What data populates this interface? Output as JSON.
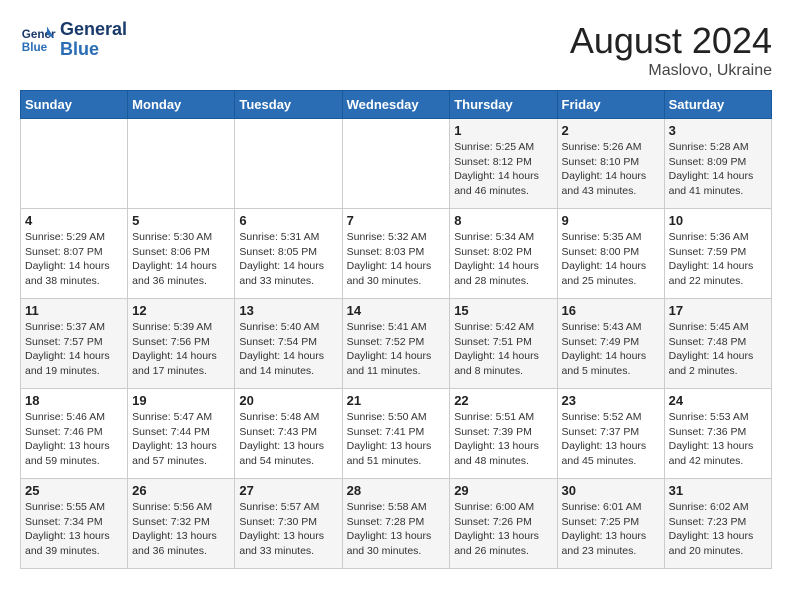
{
  "header": {
    "logo_line1": "General",
    "logo_line2": "Blue",
    "month_year": "August 2024",
    "location": "Maslovo, Ukraine"
  },
  "weekdays": [
    "Sunday",
    "Monday",
    "Tuesday",
    "Wednesday",
    "Thursday",
    "Friday",
    "Saturday"
  ],
  "weeks": [
    [
      {
        "day": "",
        "info": ""
      },
      {
        "day": "",
        "info": ""
      },
      {
        "day": "",
        "info": ""
      },
      {
        "day": "",
        "info": ""
      },
      {
        "day": "1",
        "info": "Sunrise: 5:25 AM\nSunset: 8:12 PM\nDaylight: 14 hours\nand 46 minutes."
      },
      {
        "day": "2",
        "info": "Sunrise: 5:26 AM\nSunset: 8:10 PM\nDaylight: 14 hours\nand 43 minutes."
      },
      {
        "day": "3",
        "info": "Sunrise: 5:28 AM\nSunset: 8:09 PM\nDaylight: 14 hours\nand 41 minutes."
      }
    ],
    [
      {
        "day": "4",
        "info": "Sunrise: 5:29 AM\nSunset: 8:07 PM\nDaylight: 14 hours\nand 38 minutes."
      },
      {
        "day": "5",
        "info": "Sunrise: 5:30 AM\nSunset: 8:06 PM\nDaylight: 14 hours\nand 36 minutes."
      },
      {
        "day": "6",
        "info": "Sunrise: 5:31 AM\nSunset: 8:05 PM\nDaylight: 14 hours\nand 33 minutes."
      },
      {
        "day": "7",
        "info": "Sunrise: 5:32 AM\nSunset: 8:03 PM\nDaylight: 14 hours\nand 30 minutes."
      },
      {
        "day": "8",
        "info": "Sunrise: 5:34 AM\nSunset: 8:02 PM\nDaylight: 14 hours\nand 28 minutes."
      },
      {
        "day": "9",
        "info": "Sunrise: 5:35 AM\nSunset: 8:00 PM\nDaylight: 14 hours\nand 25 minutes."
      },
      {
        "day": "10",
        "info": "Sunrise: 5:36 AM\nSunset: 7:59 PM\nDaylight: 14 hours\nand 22 minutes."
      }
    ],
    [
      {
        "day": "11",
        "info": "Sunrise: 5:37 AM\nSunset: 7:57 PM\nDaylight: 14 hours\nand 19 minutes."
      },
      {
        "day": "12",
        "info": "Sunrise: 5:39 AM\nSunset: 7:56 PM\nDaylight: 14 hours\nand 17 minutes."
      },
      {
        "day": "13",
        "info": "Sunrise: 5:40 AM\nSunset: 7:54 PM\nDaylight: 14 hours\nand 14 minutes."
      },
      {
        "day": "14",
        "info": "Sunrise: 5:41 AM\nSunset: 7:52 PM\nDaylight: 14 hours\nand 11 minutes."
      },
      {
        "day": "15",
        "info": "Sunrise: 5:42 AM\nSunset: 7:51 PM\nDaylight: 14 hours\nand 8 minutes."
      },
      {
        "day": "16",
        "info": "Sunrise: 5:43 AM\nSunset: 7:49 PM\nDaylight: 14 hours\nand 5 minutes."
      },
      {
        "day": "17",
        "info": "Sunrise: 5:45 AM\nSunset: 7:48 PM\nDaylight: 14 hours\nand 2 minutes."
      }
    ],
    [
      {
        "day": "18",
        "info": "Sunrise: 5:46 AM\nSunset: 7:46 PM\nDaylight: 13 hours\nand 59 minutes."
      },
      {
        "day": "19",
        "info": "Sunrise: 5:47 AM\nSunset: 7:44 PM\nDaylight: 13 hours\nand 57 minutes."
      },
      {
        "day": "20",
        "info": "Sunrise: 5:48 AM\nSunset: 7:43 PM\nDaylight: 13 hours\nand 54 minutes."
      },
      {
        "day": "21",
        "info": "Sunrise: 5:50 AM\nSunset: 7:41 PM\nDaylight: 13 hours\nand 51 minutes."
      },
      {
        "day": "22",
        "info": "Sunrise: 5:51 AM\nSunset: 7:39 PM\nDaylight: 13 hours\nand 48 minutes."
      },
      {
        "day": "23",
        "info": "Sunrise: 5:52 AM\nSunset: 7:37 PM\nDaylight: 13 hours\nand 45 minutes."
      },
      {
        "day": "24",
        "info": "Sunrise: 5:53 AM\nSunset: 7:36 PM\nDaylight: 13 hours\nand 42 minutes."
      }
    ],
    [
      {
        "day": "25",
        "info": "Sunrise: 5:55 AM\nSunset: 7:34 PM\nDaylight: 13 hours\nand 39 minutes."
      },
      {
        "day": "26",
        "info": "Sunrise: 5:56 AM\nSunset: 7:32 PM\nDaylight: 13 hours\nand 36 minutes."
      },
      {
        "day": "27",
        "info": "Sunrise: 5:57 AM\nSunset: 7:30 PM\nDaylight: 13 hours\nand 33 minutes."
      },
      {
        "day": "28",
        "info": "Sunrise: 5:58 AM\nSunset: 7:28 PM\nDaylight: 13 hours\nand 30 minutes."
      },
      {
        "day": "29",
        "info": "Sunrise: 6:00 AM\nSunset: 7:26 PM\nDaylight: 13 hours\nand 26 minutes."
      },
      {
        "day": "30",
        "info": "Sunrise: 6:01 AM\nSunset: 7:25 PM\nDaylight: 13 hours\nand 23 minutes."
      },
      {
        "day": "31",
        "info": "Sunrise: 6:02 AM\nSunset: 7:23 PM\nDaylight: 13 hours\nand 20 minutes."
      }
    ]
  ]
}
